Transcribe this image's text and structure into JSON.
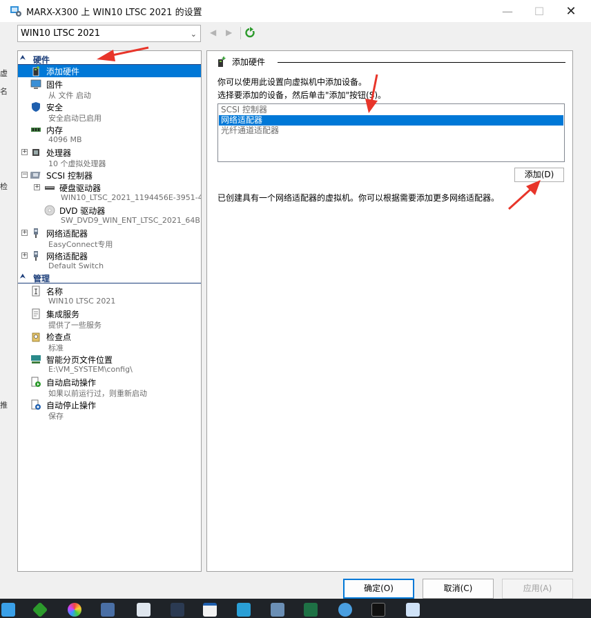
{
  "window": {
    "title": "MARX-X300 上 WIN10 LTSC 2021 的设置",
    "min_symbol": "—",
    "max_symbol": "☐",
    "close_symbol": "✕"
  },
  "toolbar": {
    "vm_selected": "WIN10 LTSC 2021",
    "back_symbol": "◀",
    "forward_symbol": "▶",
    "chevron_symbol": "⌄"
  },
  "tree": {
    "hardware_header": "硬件",
    "management_header": "管理",
    "collapse_symbol": "⮝",
    "expand_symbol": "+",
    "collapse_box_symbol": "−",
    "hardware_items": [
      {
        "name": "添加硬件",
        "sub": ""
      },
      {
        "name": "固件",
        "sub": "从 文件 启动"
      },
      {
        "name": "安全",
        "sub": "安全启动已启用"
      },
      {
        "name": "内存",
        "sub": "4096 MB"
      },
      {
        "name": "处理器",
        "sub": "10 个虚拟处理器"
      },
      {
        "name": "SCSI 控制器",
        "sub": ""
      },
      {
        "name": "硬盘驱动器",
        "sub": "WIN10_LTSC_2021_1194456E-3951-4..."
      },
      {
        "name": "DVD 驱动器",
        "sub": "SW_DVD9_WIN_ENT_LTSC_2021_64B..."
      },
      {
        "name": "网络适配器",
        "sub": "EasyConnect专用"
      },
      {
        "name": "网络适配器",
        "sub": "Default Switch"
      }
    ],
    "management_items": [
      {
        "name": "名称",
        "sub": "WIN10 LTSC 2021"
      },
      {
        "name": "集成服务",
        "sub": "提供了一些服务"
      },
      {
        "name": "检查点",
        "sub": "标准"
      },
      {
        "name": "智能分页文件位置",
        "sub": "E:\\VM_SYSTEM\\config\\"
      },
      {
        "name": "自动启动操作",
        "sub": "如果以前运行过，则重新启动"
      },
      {
        "name": "自动停止操作",
        "sub": "保存"
      }
    ]
  },
  "panel": {
    "title": "添加硬件",
    "intro_line1": "你可以使用此设置向虚拟机中添加设备。",
    "intro_line2": "选择要添加的设备，然后单击\"添加\"按钮(S)。",
    "devices": [
      "SCSI 控制器",
      "网络适配器",
      "光纤通道适配器"
    ],
    "selected_device": "网络适配器",
    "add_button": "添加(D)",
    "info_text": "已创建具有一个网络适配器的虚拟机。你可以根据需要添加更多网络适配器。"
  },
  "buttons": {
    "ok": "确定(O)",
    "cancel": "取消(C)",
    "apply": "应用(A)"
  },
  "background_window": {
    "peek_chars": [
      "虚",
      "名",
      "检",
      "推"
    ]
  },
  "colors": {
    "selection": "#0078d7",
    "section_header": "#1c3e7a",
    "annotation_arrow": "#e8352a"
  }
}
